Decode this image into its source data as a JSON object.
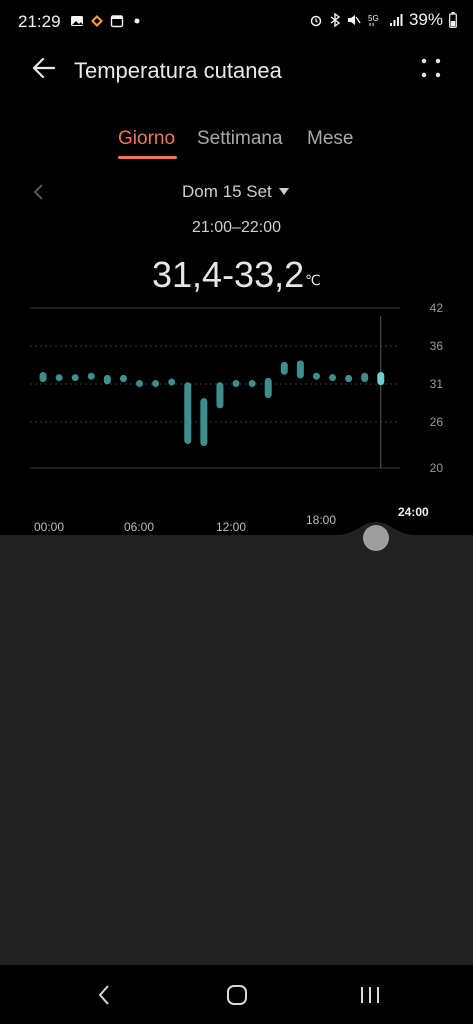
{
  "status": {
    "time": "21:29",
    "battery": "39%",
    "network": "5G"
  },
  "header": {
    "title": "Temperatura cutanea",
    "back_icon": "arrow-left-icon",
    "more_icon": "dots-grid-icon"
  },
  "tabs": [
    {
      "label": "Giorno",
      "active": true
    },
    {
      "label": "Settimana",
      "active": false
    },
    {
      "label": "Mese",
      "active": false
    }
  ],
  "date": {
    "label": "Dom 15 Set",
    "time_range": "21:00–22:00"
  },
  "reading": {
    "value": "31,4-33,2",
    "unit": "℃"
  },
  "colors": {
    "accent": "#ee7a4c",
    "bar": "#3f8e8e",
    "bar_selected": "#6fd0d0"
  },
  "chart_data": {
    "type": "bar",
    "y_ticks": [
      "42",
      "36",
      "31",
      "26",
      "20"
    ],
    "x_ticks": [
      "00:00",
      "06:00",
      "12:00",
      "18:00",
      "24:00"
    ],
    "ylim": [
      20,
      42
    ],
    "series": [
      {
        "values": [
          {
            "x": "00:30",
            "low": 31.8,
            "high": 33.2
          },
          {
            "x": "01:30",
            "low": 32.4,
            "high": 32.9
          },
          {
            "x": "02:30",
            "low": 32.4,
            "high": 32.9
          },
          {
            "x": "03:30",
            "low": 32.4,
            "high": 33.1
          },
          {
            "x": "04:30",
            "low": 31.5,
            "high": 32.8
          },
          {
            "x": "05:30",
            "low": 31.8,
            "high": 32.8
          },
          {
            "x": "06:30",
            "low": 31.5,
            "high": 32.1
          },
          {
            "x": "07:30",
            "low": 31.6,
            "high": 32.1
          },
          {
            "x": "08:30",
            "low": 31.6,
            "high": 32.3
          },
          {
            "x": "09:30",
            "low": 23.3,
            "high": 31.8
          },
          {
            "x": "10:30",
            "low": 23.0,
            "high": 29.6
          },
          {
            "x": "11:30",
            "low": 28.2,
            "high": 31.8
          },
          {
            "x": "12:30",
            "low": 31.2,
            "high": 32.1
          },
          {
            "x": "13:30",
            "low": 31.2,
            "high": 32.1
          },
          {
            "x": "14:30",
            "low": 29.6,
            "high": 32.4
          },
          {
            "x": "15:30",
            "low": 32.8,
            "high": 34.6
          },
          {
            "x": "16:30",
            "low": 32.3,
            "high": 34.8
          },
          {
            "x": "17:30",
            "low": 32.4,
            "high": 33.1
          },
          {
            "x": "18:30",
            "low": 32.1,
            "high": 32.9
          },
          {
            "x": "19:30",
            "low": 31.8,
            "high": 32.8
          },
          {
            "x": "20:30",
            "low": 31.8,
            "high": 33.1
          },
          {
            "x": "21:30",
            "low": 31.4,
            "high": 33.2
          }
        ]
      }
    ],
    "selected_x": "21:30",
    "grid": true
  }
}
